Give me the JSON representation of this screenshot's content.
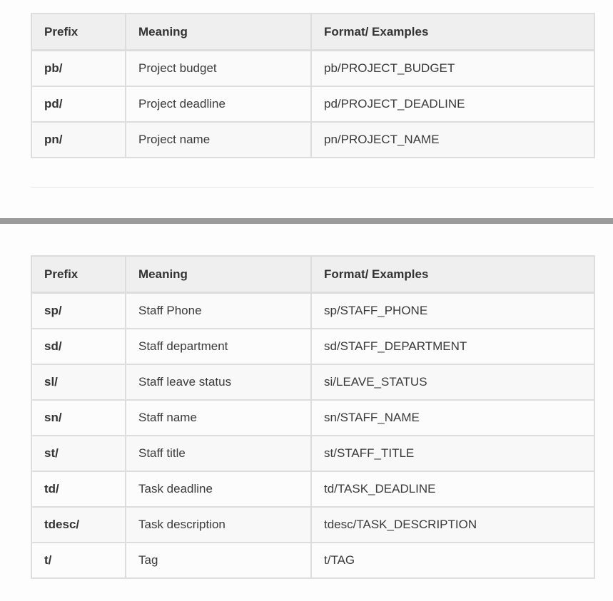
{
  "project_table": {
    "headers": [
      "Prefix",
      "Meaning",
      "Format/ Examples"
    ],
    "rows": [
      {
        "prefix": "pb/",
        "meaning": "Project budget",
        "format": "pb/PROJECT_BUDGET"
      },
      {
        "prefix": "pd/",
        "meaning": "Project deadline",
        "format": "pd/PROJECT_DEADLINE"
      },
      {
        "prefix": "pn/",
        "meaning": "Project name",
        "format": "pn/PROJECT_NAME"
      }
    ]
  },
  "staff_table": {
    "headers": [
      "Prefix",
      "Meaning",
      "Format/ Examples"
    ],
    "rows": [
      {
        "prefix": "sp/",
        "meaning": "Staff Phone",
        "format": "sp/STAFF_PHONE"
      },
      {
        "prefix": "sd/",
        "meaning": "Staff department",
        "format": "sd/STAFF_DEPARTMENT"
      },
      {
        "prefix": "sl/",
        "meaning": "Staff leave status",
        "format": "si/LEAVE_STATUS"
      },
      {
        "prefix": "sn/",
        "meaning": "Staff name",
        "format": "sn/STAFF_NAME"
      },
      {
        "prefix": "st/",
        "meaning": "Staff title",
        "format": "st/STAFF_TITLE"
      },
      {
        "prefix": "td/",
        "meaning": "Task deadline",
        "format": "td/TASK_DEADLINE"
      },
      {
        "prefix": "tdesc/",
        "meaning": "Task description",
        "format": "tdesc/TASK_DESCRIPTION"
      },
      {
        "prefix": "t/",
        "meaning": "Tag",
        "format": "t/TAG"
      }
    ]
  }
}
